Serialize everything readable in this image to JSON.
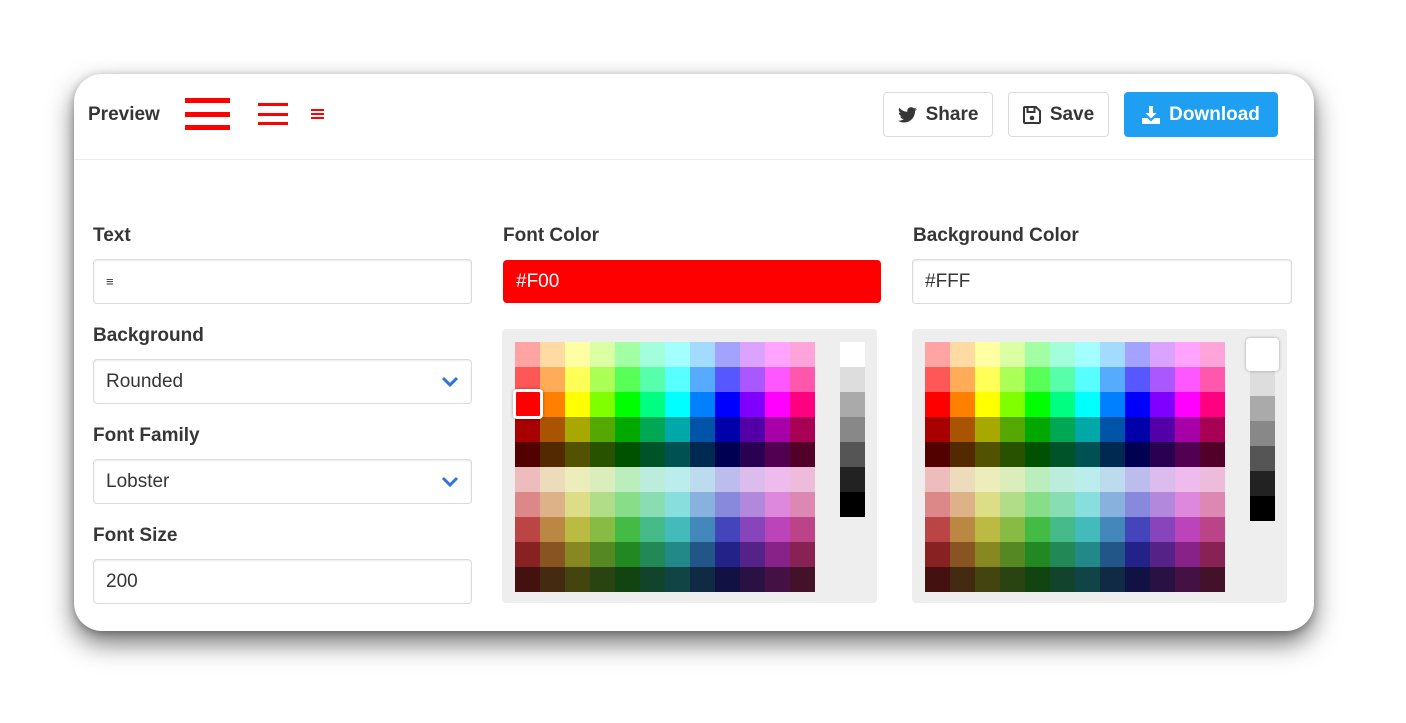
{
  "header": {
    "title": "Preview",
    "share_label": "Share",
    "save_label": "Save",
    "download_label": "Download",
    "icon_color": "#ff0000"
  },
  "form": {
    "text": {
      "label": "Text",
      "value": "≡"
    },
    "background": {
      "label": "Background",
      "value": "Rounded"
    },
    "font_family": {
      "label": "Font Family",
      "value": "Lobster"
    },
    "font_size": {
      "label": "Font Size",
      "value": "200"
    },
    "font_color": {
      "label": "Font Color",
      "value": "#F00"
    },
    "background_color": {
      "label": "Background Color",
      "value": "#FFF"
    }
  },
  "colors": {
    "accent": "#1e9ff2",
    "selected_font_color": "#ff0000",
    "selected_background_color": "#ffffff"
  },
  "palette": [
    [
      "#ffa3a3",
      "#ffdba3",
      "#ffffa3",
      "#dbffa3",
      "#a3ffa3",
      "#a3ffdb",
      "#a3ffff",
      "#a3dbff",
      "#a3a3ff",
      "#dba3ff",
      "#ffa3ff",
      "#ffa3db"
    ],
    [
      "#ff5757",
      "#ffab57",
      "#ffff57",
      "#abff57",
      "#57ff57",
      "#57ffab",
      "#57ffff",
      "#57abff",
      "#5757ff",
      "#ab57ff",
      "#ff57ff",
      "#ff57ab"
    ],
    [
      "#ff0000",
      "#ff8000",
      "#ffff00",
      "#80ff00",
      "#00ff00",
      "#00ff80",
      "#00ffff",
      "#0080ff",
      "#0000ff",
      "#8000ff",
      "#ff00ff",
      "#ff0080"
    ],
    [
      "#a80000",
      "#a85400",
      "#a8a800",
      "#54a800",
      "#00a800",
      "#00a854",
      "#00a8a8",
      "#0054a8",
      "#0000a8",
      "#5400a8",
      "#a800a8",
      "#a80054"
    ],
    [
      "#520000",
      "#522900",
      "#525200",
      "#295200",
      "#005200",
      "#005229",
      "#005252",
      "#002952",
      "#000052",
      "#290052",
      "#520052",
      "#520029"
    ],
    [
      "#edbcbc",
      "#eddcbc",
      "#ededbc",
      "#dcedbc",
      "#bcedbc",
      "#bceddc",
      "#bceded",
      "#bcdced",
      "#bcbced",
      "#dcbced",
      "#edbced",
      "#edbcdc"
    ],
    [
      "#dd8888",
      "#ddb288",
      "#dddd88",
      "#b2dd88",
      "#88dd88",
      "#88ddb2",
      "#88dddd",
      "#88b2dd",
      "#8888dd",
      "#b288dd",
      "#dd88dd",
      "#dd88b2"
    ],
    [
      "#bb4444",
      "#bb8844",
      "#bbbb44",
      "#88bb44",
      "#44bb44",
      "#44bb88",
      "#44bbbb",
      "#4488bb",
      "#4444bb",
      "#8844bb",
      "#bb44bb",
      "#bb4488"
    ],
    [
      "#882222",
      "#885522",
      "#888822",
      "#558822",
      "#228822",
      "#228855",
      "#228888",
      "#225588",
      "#222288",
      "#552288",
      "#882288",
      "#882255"
    ],
    [
      "#441111",
      "#442a11",
      "#444411",
      "#2a4411",
      "#114411",
      "#11442a",
      "#114444",
      "#112a44",
      "#111144",
      "#2a1144",
      "#441144",
      "#44112a"
    ]
  ],
  "grays": [
    "#ffffff",
    "#dddddd",
    "#aaaaaa",
    "#888888",
    "#555555",
    "#222222",
    "#000000"
  ]
}
